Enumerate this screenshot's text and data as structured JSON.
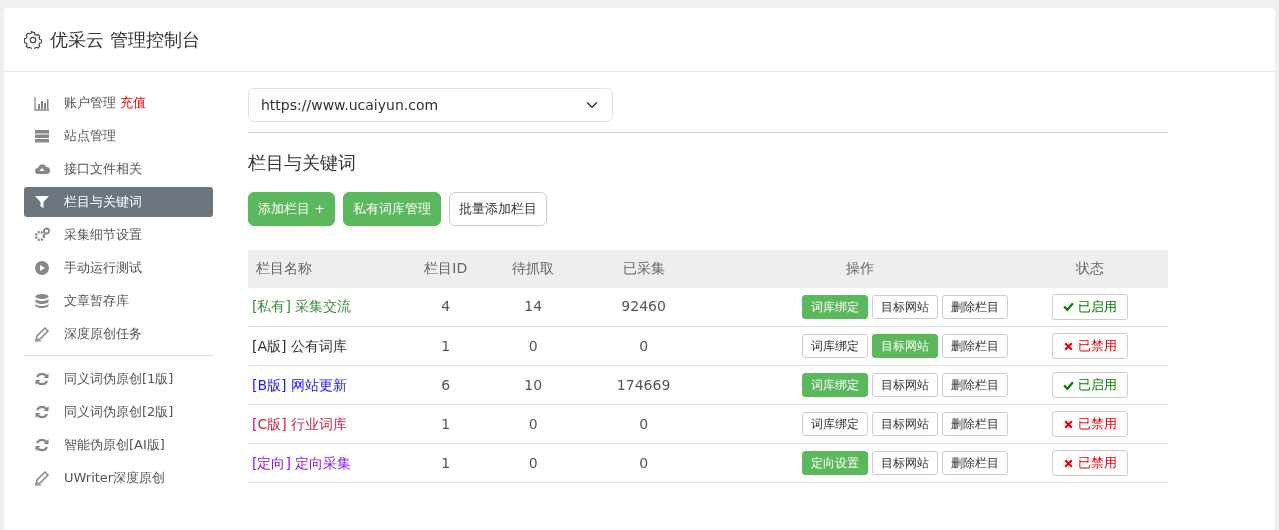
{
  "header": {
    "title": "优采云 管理控制台"
  },
  "sidebar": {
    "groups": [
      {
        "items": [
          {
            "label": "账户管理",
            "badge": "充值",
            "selected": false
          },
          {
            "label": "站点管理",
            "selected": false
          },
          {
            "label": "接口文件相关",
            "selected": false
          },
          {
            "label": "栏目与关键词",
            "selected": true
          },
          {
            "label": "采集细节设置",
            "selected": false
          },
          {
            "label": "手动运行测试",
            "selected": false
          },
          {
            "label": "文章暂存库",
            "selected": false
          },
          {
            "label": "深度原创任务",
            "selected": false
          }
        ]
      },
      {
        "items": [
          {
            "label": "同义词伪原创[1版]",
            "selected": false
          },
          {
            "label": "同义词伪原创[2版]",
            "selected": false
          },
          {
            "label": "智能伪原创[AI版]",
            "selected": false
          },
          {
            "label": "UWriter深度原创",
            "selected": false
          }
        ]
      }
    ]
  },
  "site_select": {
    "value": "https://www.ucaiyun.com"
  },
  "section_title": "栏目与关键词",
  "toolbar": [
    {
      "label": "添加栏目 +",
      "filled": true
    },
    {
      "label": "私有词库管理",
      "filled": true
    },
    {
      "label": "批量添加栏目",
      "filled": false
    }
  ],
  "table": {
    "columns": [
      "栏目名称",
      "栏目ID",
      "待抓取",
      "已采集",
      "操作",
      "状态"
    ],
    "rows": [
      {
        "tag": "[私有]",
        "name": "采集交流",
        "color": "#3c8d3c",
        "id": "4",
        "pending": "14",
        "collected": "92460",
        "actions": [
          {
            "label": "词库绑定",
            "filled": true
          },
          {
            "label": "目标网站",
            "filled": false
          },
          {
            "label": "删除栏目",
            "filled": false
          }
        ],
        "status": {
          "label": "已启用",
          "enabled": true
        }
      },
      {
        "tag": "[A版]",
        "name": "公有词库",
        "color": "#333333",
        "id": "1",
        "pending": "0",
        "collected": "0",
        "actions": [
          {
            "label": "词库绑定",
            "filled": false
          },
          {
            "label": "目标网站",
            "filled": true
          },
          {
            "label": "删除栏目",
            "filled": false
          }
        ],
        "status": {
          "label": "已禁用",
          "enabled": false
        }
      },
      {
        "tag": "[B版]",
        "name": "网站更新",
        "color": "#1a1aff",
        "id": "6",
        "pending": "10",
        "collected": "174669",
        "actions": [
          {
            "label": "词库绑定",
            "filled": true
          },
          {
            "label": "目标网站",
            "filled": false
          },
          {
            "label": "删除栏目",
            "filled": false
          }
        ],
        "status": {
          "label": "已启用",
          "enabled": true
        }
      },
      {
        "tag": "[C版]",
        "name": "行业词库",
        "color": "#c7254e",
        "id": "1",
        "pending": "0",
        "collected": "0",
        "actions": [
          {
            "label": "词库绑定",
            "filled": false
          },
          {
            "label": "目标网站",
            "filled": false
          },
          {
            "label": "删除栏目",
            "filled": false
          }
        ],
        "status": {
          "label": "已禁用",
          "enabled": false
        }
      },
      {
        "tag": "[定向]",
        "name": "定向采集",
        "color": "#8a1ae0",
        "id": "1",
        "pending": "0",
        "collected": "0",
        "actions": [
          {
            "label": "定向设置",
            "filled": true
          },
          {
            "label": "目标网站",
            "filled": false
          },
          {
            "label": "删除栏目",
            "filled": false
          }
        ],
        "status": {
          "label": "已禁用",
          "enabled": false
        }
      }
    ]
  }
}
